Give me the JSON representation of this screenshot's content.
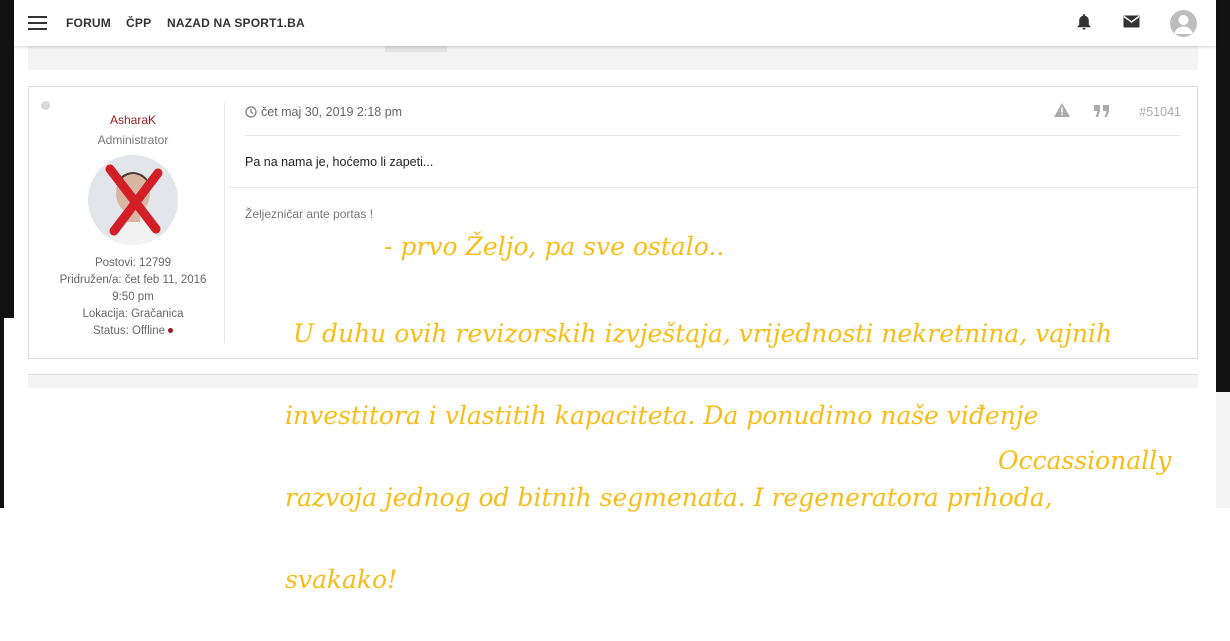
{
  "navbar": {
    "links": [
      "FORUM",
      "ČPP",
      "NAZAD NA SPORT1.BA"
    ],
    "icons": [
      "menu-icon",
      "bell-icon",
      "mail-icon",
      "user-avatar-icon"
    ]
  },
  "post": {
    "author": {
      "name": "AsharaK",
      "rank": "Administrator",
      "posts": "Postovi: 12799",
      "joined_line1": "Pridružen/a: čet feb 11, 2016",
      "joined_line2": "9:50 pm",
      "location": "Lokacija: Gračanica",
      "status": "Status: Offline"
    },
    "date": "čet maj 30, 2019 2:18 pm",
    "post_number": "#51041",
    "content": "Pa na nama je, hoćemo li zapeti...",
    "signature": "Željezničar ante portas !"
  },
  "overlay": {
    "line1": "- prvo Željo, pa sve ostalo..",
    "paragraph_lines": [
      " U duhu ovih revizorskih izvještaja, vrijednosti nekretnina, vajnih",
      "investitora i vlastitih kapaciteta. Da ponudimo naše viđenje",
      "razvoja jednog od bitnih segmenata. I regeneratora prihoda,",
      "svakako!"
    ],
    "signoff": "Occassionally",
    "color": "#f7bd16"
  },
  "colors": {
    "username": "#9b1c1c",
    "status_offline": "#9b1c1c"
  }
}
